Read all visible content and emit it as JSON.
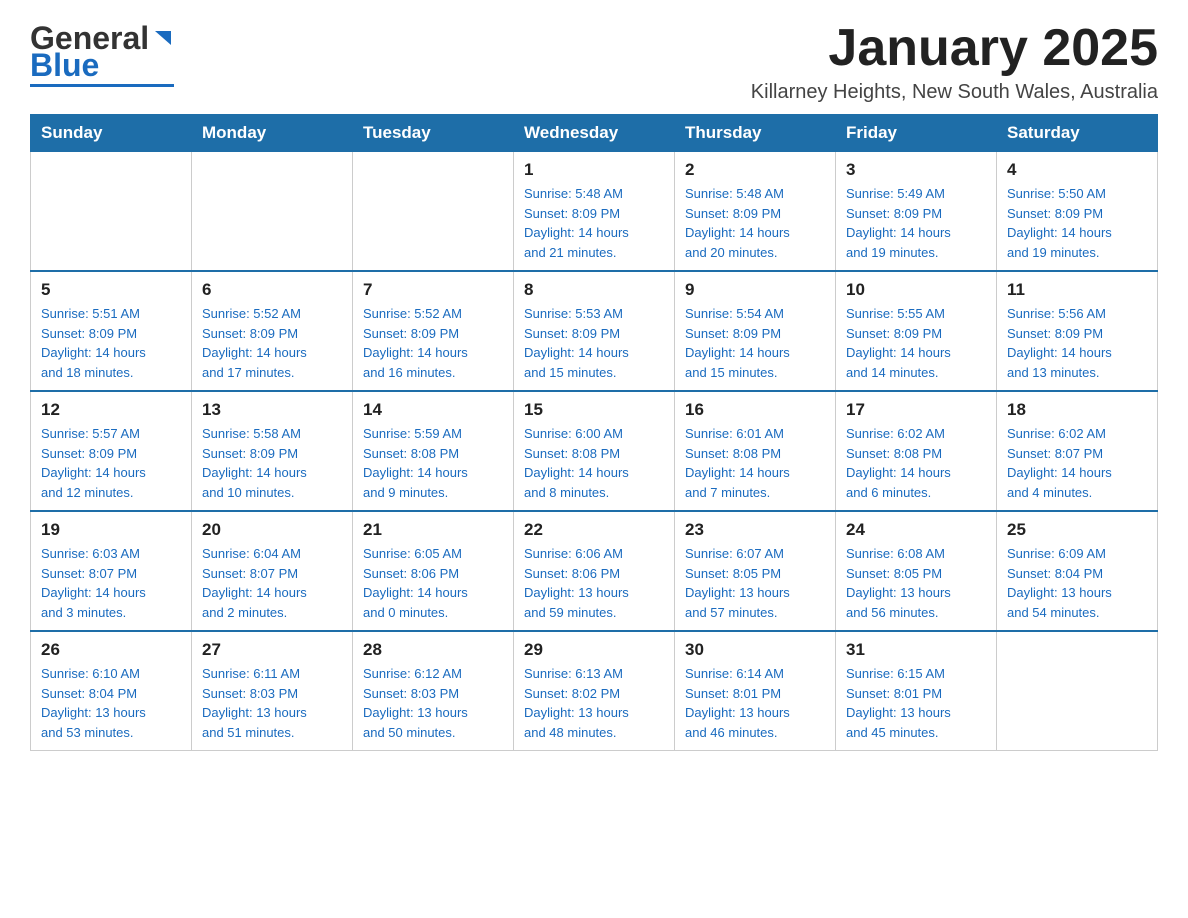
{
  "header": {
    "logo_text_black": "General",
    "logo_text_blue": "Blue",
    "month_year": "January 2025",
    "location": "Killarney Heights, New South Wales, Australia"
  },
  "weekdays": [
    "Sunday",
    "Monday",
    "Tuesday",
    "Wednesday",
    "Thursday",
    "Friday",
    "Saturday"
  ],
  "weeks": [
    [
      {
        "day": "",
        "info": ""
      },
      {
        "day": "",
        "info": ""
      },
      {
        "day": "",
        "info": ""
      },
      {
        "day": "1",
        "info": "Sunrise: 5:48 AM\nSunset: 8:09 PM\nDaylight: 14 hours\nand 21 minutes."
      },
      {
        "day": "2",
        "info": "Sunrise: 5:48 AM\nSunset: 8:09 PM\nDaylight: 14 hours\nand 20 minutes."
      },
      {
        "day": "3",
        "info": "Sunrise: 5:49 AM\nSunset: 8:09 PM\nDaylight: 14 hours\nand 19 minutes."
      },
      {
        "day": "4",
        "info": "Sunrise: 5:50 AM\nSunset: 8:09 PM\nDaylight: 14 hours\nand 19 minutes."
      }
    ],
    [
      {
        "day": "5",
        "info": "Sunrise: 5:51 AM\nSunset: 8:09 PM\nDaylight: 14 hours\nand 18 minutes."
      },
      {
        "day": "6",
        "info": "Sunrise: 5:52 AM\nSunset: 8:09 PM\nDaylight: 14 hours\nand 17 minutes."
      },
      {
        "day": "7",
        "info": "Sunrise: 5:52 AM\nSunset: 8:09 PM\nDaylight: 14 hours\nand 16 minutes."
      },
      {
        "day": "8",
        "info": "Sunrise: 5:53 AM\nSunset: 8:09 PM\nDaylight: 14 hours\nand 15 minutes."
      },
      {
        "day": "9",
        "info": "Sunrise: 5:54 AM\nSunset: 8:09 PM\nDaylight: 14 hours\nand 15 minutes."
      },
      {
        "day": "10",
        "info": "Sunrise: 5:55 AM\nSunset: 8:09 PM\nDaylight: 14 hours\nand 14 minutes."
      },
      {
        "day": "11",
        "info": "Sunrise: 5:56 AM\nSunset: 8:09 PM\nDaylight: 14 hours\nand 13 minutes."
      }
    ],
    [
      {
        "day": "12",
        "info": "Sunrise: 5:57 AM\nSunset: 8:09 PM\nDaylight: 14 hours\nand 12 minutes."
      },
      {
        "day": "13",
        "info": "Sunrise: 5:58 AM\nSunset: 8:09 PM\nDaylight: 14 hours\nand 10 minutes."
      },
      {
        "day": "14",
        "info": "Sunrise: 5:59 AM\nSunset: 8:08 PM\nDaylight: 14 hours\nand 9 minutes."
      },
      {
        "day": "15",
        "info": "Sunrise: 6:00 AM\nSunset: 8:08 PM\nDaylight: 14 hours\nand 8 minutes."
      },
      {
        "day": "16",
        "info": "Sunrise: 6:01 AM\nSunset: 8:08 PM\nDaylight: 14 hours\nand 7 minutes."
      },
      {
        "day": "17",
        "info": "Sunrise: 6:02 AM\nSunset: 8:08 PM\nDaylight: 14 hours\nand 6 minutes."
      },
      {
        "day": "18",
        "info": "Sunrise: 6:02 AM\nSunset: 8:07 PM\nDaylight: 14 hours\nand 4 minutes."
      }
    ],
    [
      {
        "day": "19",
        "info": "Sunrise: 6:03 AM\nSunset: 8:07 PM\nDaylight: 14 hours\nand 3 minutes."
      },
      {
        "day": "20",
        "info": "Sunrise: 6:04 AM\nSunset: 8:07 PM\nDaylight: 14 hours\nand 2 minutes."
      },
      {
        "day": "21",
        "info": "Sunrise: 6:05 AM\nSunset: 8:06 PM\nDaylight: 14 hours\nand 0 minutes."
      },
      {
        "day": "22",
        "info": "Sunrise: 6:06 AM\nSunset: 8:06 PM\nDaylight: 13 hours\nand 59 minutes."
      },
      {
        "day": "23",
        "info": "Sunrise: 6:07 AM\nSunset: 8:05 PM\nDaylight: 13 hours\nand 57 minutes."
      },
      {
        "day": "24",
        "info": "Sunrise: 6:08 AM\nSunset: 8:05 PM\nDaylight: 13 hours\nand 56 minutes."
      },
      {
        "day": "25",
        "info": "Sunrise: 6:09 AM\nSunset: 8:04 PM\nDaylight: 13 hours\nand 54 minutes."
      }
    ],
    [
      {
        "day": "26",
        "info": "Sunrise: 6:10 AM\nSunset: 8:04 PM\nDaylight: 13 hours\nand 53 minutes."
      },
      {
        "day": "27",
        "info": "Sunrise: 6:11 AM\nSunset: 8:03 PM\nDaylight: 13 hours\nand 51 minutes."
      },
      {
        "day": "28",
        "info": "Sunrise: 6:12 AM\nSunset: 8:03 PM\nDaylight: 13 hours\nand 50 minutes."
      },
      {
        "day": "29",
        "info": "Sunrise: 6:13 AM\nSunset: 8:02 PM\nDaylight: 13 hours\nand 48 minutes."
      },
      {
        "day": "30",
        "info": "Sunrise: 6:14 AM\nSunset: 8:01 PM\nDaylight: 13 hours\nand 46 minutes."
      },
      {
        "day": "31",
        "info": "Sunrise: 6:15 AM\nSunset: 8:01 PM\nDaylight: 13 hours\nand 45 minutes."
      },
      {
        "day": "",
        "info": ""
      }
    ]
  ]
}
